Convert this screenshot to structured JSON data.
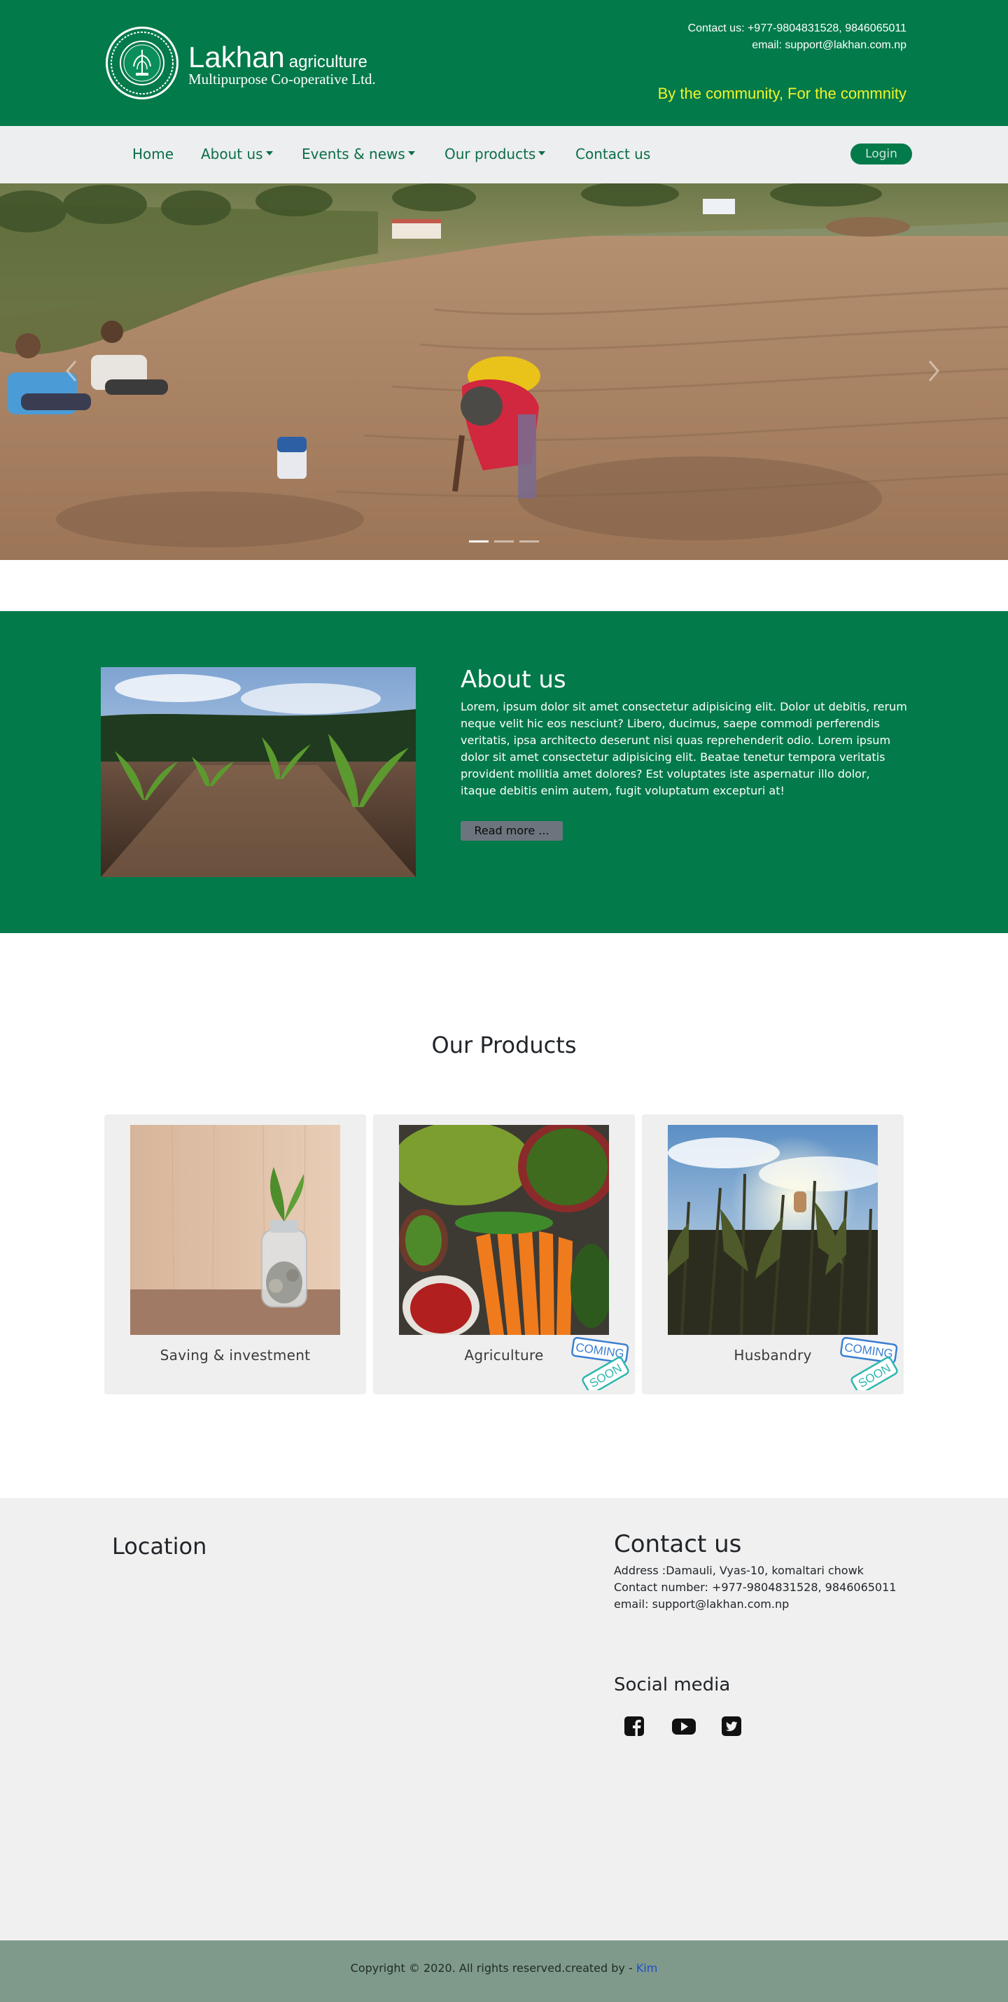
{
  "header": {
    "brand_name": "Lakhan",
    "brand_suffix": "agriculture",
    "brand_tagline": "Multipurpose Co-operative Ltd.",
    "contact_phone": "Contact us: +977-9804831528, 9846065011",
    "contact_email": "email: support@lakhan.com.np",
    "slogan": "By the community, For the commnity"
  },
  "nav": {
    "items": [
      {
        "label": "Home",
        "dropdown": false
      },
      {
        "label": "About us",
        "dropdown": true
      },
      {
        "label": "Events & news",
        "dropdown": true
      },
      {
        "label": "Our products",
        "dropdown": true
      },
      {
        "label": "Contact us",
        "dropdown": false
      }
    ],
    "login_label": "Login"
  },
  "hero": {
    "slide_count": 3,
    "active_slide": 1
  },
  "about": {
    "title": "About us",
    "text": "Lorem, ipsum dolor sit amet consectetur adipisicing elit. Dolor ut debitis, rerum neque velit hic eos nesciunt? Libero, ducimus, saepe commodi perferendis veritatis, ipsa architecto deserunt nisi quas reprehenderit odio. Lorem ipsum dolor sit amet consectetur adipisicing elit. Beatae tenetur tempora veritatis provident mollitia amet dolores? Est voluptates iste aspernatur illo dolor, itaque debitis enim autem, fugit voluptatum excepturi at!",
    "read_more_label": "Read more ..."
  },
  "products": {
    "title": "Our Products",
    "items": [
      {
        "label": "Saving & investment",
        "coming_soon": false
      },
      {
        "label": "Agriculture",
        "coming_soon": true
      },
      {
        "label": "Husbandry",
        "coming_soon": true
      }
    ]
  },
  "footer": {
    "location_title": "Location",
    "contact_title": "Contact us",
    "address": "Address :Damauli, Vyas-10, komaltari chowk",
    "contact_number": "Contact number: +977-9804831528, 9846065011",
    "email": "email: support@lakhan.com.np",
    "social_title": "Social media",
    "social_icons": [
      "facebook-icon",
      "youtube-icon",
      "twitter-icon"
    ],
    "copyright_prefix": "Copyright © 2020. All rights reserved.created by - ",
    "copyright_author": "Kim"
  },
  "colors": {
    "brand_green": "#027a4a",
    "nav_bg": "#eceef0",
    "slogan_yellow": "#f0f529",
    "footer_bg": "#f0f0f0",
    "copyright_bg": "#7f9a8b"
  }
}
